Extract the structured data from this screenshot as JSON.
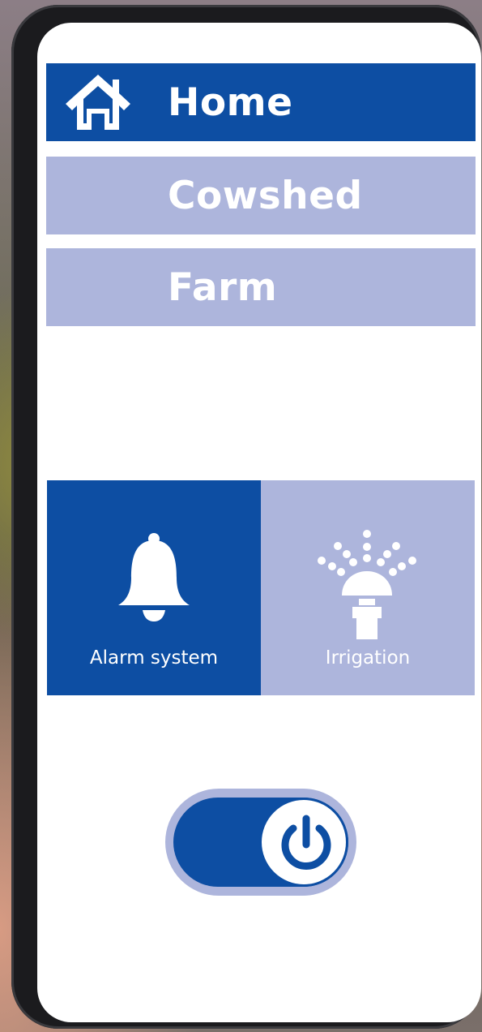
{
  "nav": {
    "items": [
      {
        "label": "Home",
        "icon": "home-icon",
        "active": true
      },
      {
        "label": "Cowshed",
        "active": false
      },
      {
        "label": "Farm",
        "active": false
      }
    ]
  },
  "tiles": [
    {
      "label": "Alarm system",
      "icon": "bell-icon",
      "active": true
    },
    {
      "label": "Irrigation",
      "icon": "sprinkler-icon",
      "active": false
    }
  ],
  "power_toggle": {
    "state": "on",
    "icon": "power-icon"
  },
  "colors": {
    "primary": "#0d4ea3",
    "inactive": "#adb5dc",
    "screen": "#ffffff",
    "frame": "#1b1b1e"
  }
}
